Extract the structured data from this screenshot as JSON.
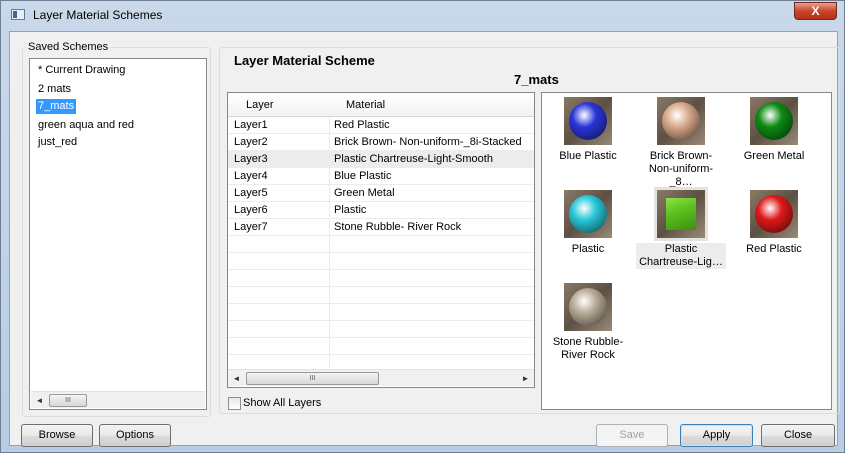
{
  "window": {
    "title": "Layer Material Schemes",
    "close": "X"
  },
  "saved_schemes": {
    "label": "Saved Schemes",
    "items": [
      "* Current Drawing",
      "2 mats",
      "7_mats",
      "green aqua and red",
      "just_red"
    ],
    "selected": "7_mats"
  },
  "scheme": {
    "title": "Layer Material Scheme",
    "name": "7_mats"
  },
  "table": {
    "columns": [
      "Layer",
      "Material"
    ],
    "rows": [
      [
        "Layer1",
        "Red Plastic"
      ],
      [
        "Layer2",
        "Brick Brown- Non-uniform-_8i-Stacked"
      ],
      [
        "Layer3",
        "Plastic Chartreuse-Light-Smooth"
      ],
      [
        "Layer4",
        "Blue Plastic"
      ],
      [
        "Layer5",
        "Green Metal"
      ],
      [
        "Layer6",
        "Plastic"
      ],
      [
        "Layer7",
        "Stone Rubble- River Rock"
      ]
    ],
    "selected_row": 2
  },
  "show_all_layers": {
    "label": "Show All Layers",
    "checked": false
  },
  "materials": [
    {
      "l1": "Blue Plastic",
      "l2": "",
      "color": "#2a35d8"
    },
    {
      "l1": "Brick Brown-",
      "l2": "Non-uniform-_8…",
      "color": "#d9a98a"
    },
    {
      "l1": "Green Metal",
      "l2": "",
      "color": "#0d8a12"
    },
    {
      "l1": "Plastic",
      "l2": "",
      "color": "#28c8d8"
    },
    {
      "l1": "Plastic",
      "l2": "Chartreuse-Lig…",
      "color": "#5cc21e"
    },
    {
      "l1": "Red Plastic",
      "l2": "",
      "color": "#e01818"
    },
    {
      "l1": "Stone Rubble-",
      "l2": "River Rock",
      "color": "#b8ab98"
    }
  ],
  "buttons": {
    "browse": "Browse",
    "options": "Options",
    "save": "Save",
    "apply": "Apply",
    "close": "Close"
  },
  "scroll": {
    "left": "◄",
    "right": "►",
    "grip": "III"
  }
}
